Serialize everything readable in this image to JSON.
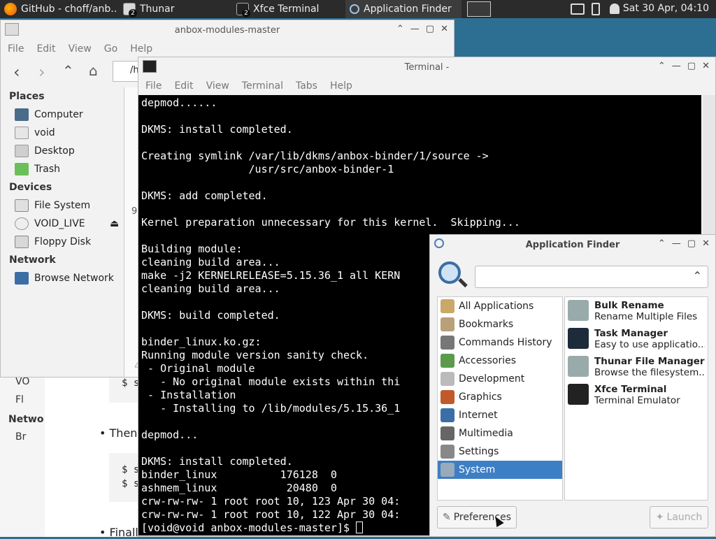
{
  "panel": {
    "tasks": [
      {
        "label": "GitHub - choff/anb...",
        "icon": "firefox-icon"
      },
      {
        "label": "Thunar",
        "badge": "2",
        "icon": "folder-icon"
      },
      {
        "label": "Xfce Terminal",
        "badge": "2",
        "icon": "terminal-icon"
      },
      {
        "label": "Application Finder",
        "icon": "search-icon"
      }
    ],
    "clock": "Sat 30 Apr, 04:10"
  },
  "thunar": {
    "title": "anbox-modules-master",
    "menu": [
      "File",
      "Edit",
      "View",
      "Go",
      "Help"
    ],
    "path_fragment": "/h",
    "places_header": "Places",
    "places": [
      "Computer",
      "void",
      "Desktop",
      "Trash"
    ],
    "devices_header": "Devices",
    "devices": [
      "File System",
      "VOID_LIVE",
      "Floppy Disk"
    ],
    "network_header": "Network",
    "network": [
      "Browse Network"
    ],
    "status_fragment": "9",
    "status_fragment2": "4"
  },
  "background_window": {
    "cmd1": "$ s",
    "bullet_then": "Then",
    "cmd2": "$ s",
    "cmd3": "$ s",
    "bullet_final": "Finall",
    "side_frag1": "VO",
    "side_frag2": "Fl",
    "side_frag3": "Netwo",
    "side_frag4": "Br"
  },
  "terminal": {
    "title": "Terminal -",
    "menu": [
      "File",
      "Edit",
      "View",
      "Terminal",
      "Tabs",
      "Help"
    ],
    "lines": [
      "depmod......",
      "",
      "DKMS: install completed.",
      "",
      "Creating symlink /var/lib/dkms/anbox-binder/1/source ->",
      "                 /usr/src/anbox-binder-1",
      "",
      "DKMS: add completed.",
      "",
      "Kernel preparation unnecessary for this kernel.  Skipping...",
      "",
      "Building module:",
      "cleaning build area...",
      "make -j2 KERNELRELEASE=5.15.36_1 all KERN",
      "cleaning build area...",
      "",
      "DKMS: build completed.",
      "",
      "binder_linux.ko.gz:",
      "Running module version sanity check.",
      " - Original module",
      "   - No original module exists within thi",
      " - Installation",
      "   - Installing to /lib/modules/5.15.36_1",
      "",
      "depmod...",
      "",
      "DKMS: install completed.",
      "binder_linux          176128  0",
      "ashmem_linux           20480  0",
      "crw-rw-rw- 1 root root 10, 123 Apr 30 04:",
      "crw-rw-rw- 1 root root 10, 122 Apr 30 04:",
      "[void@void anbox-modules-master]$ "
    ]
  },
  "appfinder": {
    "title": "Application Finder",
    "search_value": "",
    "categories": [
      {
        "label": "All Applications",
        "icon": "all-apps-icon"
      },
      {
        "label": "Bookmarks",
        "icon": "bookmarks-icon"
      },
      {
        "label": "Commands History",
        "icon": "history-icon"
      },
      {
        "label": "Accessories",
        "icon": "accessories-icon"
      },
      {
        "label": "Development",
        "icon": "development-icon"
      },
      {
        "label": "Graphics",
        "icon": "graphics-icon"
      },
      {
        "label": "Internet",
        "icon": "internet-icon"
      },
      {
        "label": "Multimedia",
        "icon": "multimedia-icon"
      },
      {
        "label": "Settings",
        "icon": "settings-icon"
      },
      {
        "label": "System",
        "icon": "system-icon",
        "selected": true
      }
    ],
    "apps": [
      {
        "name": "Bulk Rename",
        "desc": "Rename Multiple Files",
        "icon": "bulk-rename-icon"
      },
      {
        "name": "Task Manager",
        "desc": "Easy to use applicatio...",
        "icon": "task-manager-icon"
      },
      {
        "name": "Thunar File Manager",
        "desc": "Browse the filesystem...",
        "icon": "thunar-icon"
      },
      {
        "name": "Xfce Terminal",
        "desc": "Terminal Emulator",
        "icon": "xfce-terminal-icon"
      }
    ],
    "preferences_label": "Preferences",
    "launch_label": "Launch"
  }
}
